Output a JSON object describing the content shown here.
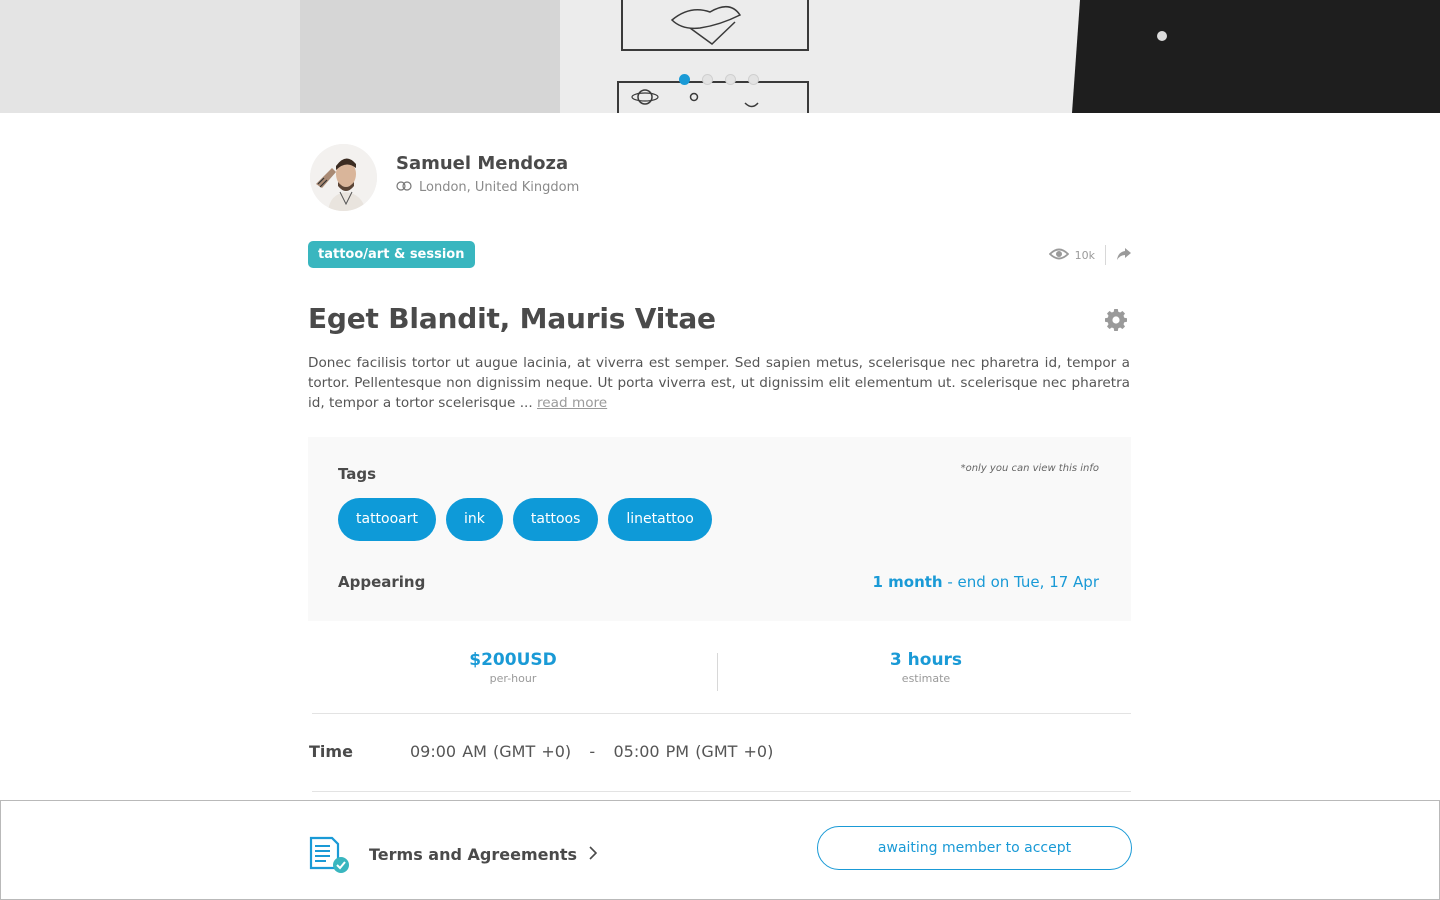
{
  "carousel": {
    "slide_count": 4,
    "active_index": 0
  },
  "profile": {
    "name": "Samuel Mendoza",
    "location": "London, United Kingdom"
  },
  "listing": {
    "category": "tattoo/art & session",
    "views": "10k",
    "title": "Eget Blandit, Mauris Vitae",
    "description": "Donec facilisis tortor ut augue lacinia, at viverra est semper. Sed sapien metus, scelerisque nec pharetra id, tempor a tortor. Pellentesque non dignissim neque. Ut porta viverra est, ut dignissim elit elementum ut.  scelerisque nec pharetra id, tempor a tortor  scelerisque ...",
    "read_more": "read more"
  },
  "info": {
    "tags_label": "Tags",
    "private_note": "*only you can view this info",
    "tags": [
      "tattooart",
      "ink",
      "tattoos",
      "linetattoo"
    ],
    "appearing_label": "Appearing",
    "appearing_duration": "1 month",
    "appearing_end": " - end on Tue, 17 Apr"
  },
  "pricing": {
    "price": "$200USD",
    "price_unit": "per-hour",
    "duration": "3 hours",
    "duration_unit": "estimate"
  },
  "schedule": {
    "time_label": "Time",
    "time_range": "09:00 AM (GMT +0)   -   05:00 PM (GMT +0)"
  },
  "footer": {
    "terms_label": "Terms and Agreements",
    "status_button": "awaiting member to accept"
  },
  "colors": {
    "accent_blue": "#1a9ad6",
    "category_teal": "#39b6bf",
    "tag_blue": "#0e9ad8"
  },
  "icons": [
    "eye-icon",
    "share-icon",
    "gear-icon",
    "location-icon",
    "document-check-icon",
    "chevron-right-icon"
  ]
}
